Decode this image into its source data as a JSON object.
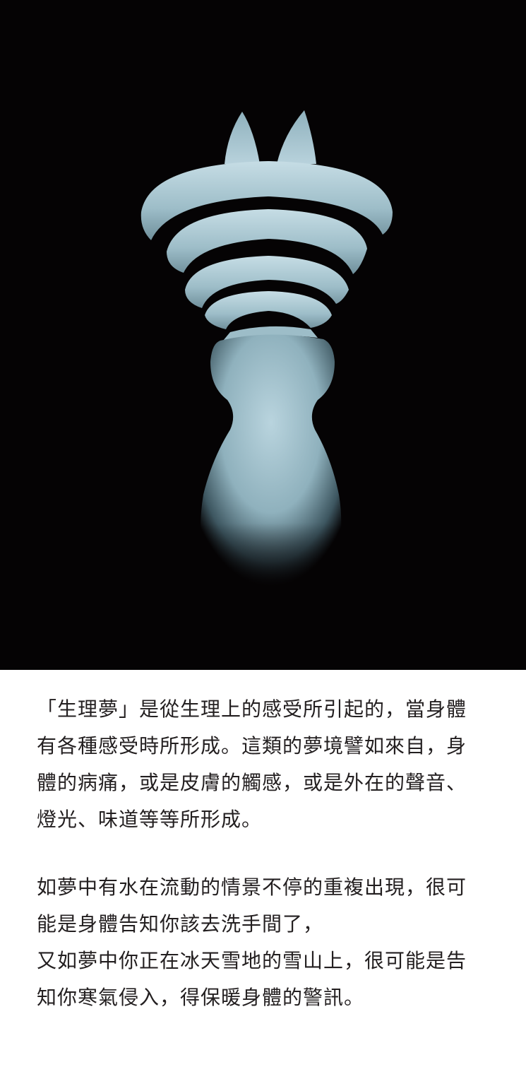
{
  "illustration": {
    "subject": "glowing-chess-piece-figure",
    "background_color": "#050304",
    "figure_color": "#a9cad6"
  },
  "paragraph_1": {
    "lines": [
      "「生理夢」是從生理上的感受所引起的，當身體",
      "有各種感受時所形成。這類的夢境譬如來自，身",
      "體的病痛，或是皮膚的觸感，或是外在的聲音、",
      "燈光、味道等等所形成。"
    ]
  },
  "paragraph_2": {
    "lines": [
      "如夢中有水在流動的情景不停的重複出現，很可",
      "能是身體告知你該去洗手間了，",
      "又如夢中你正在冰天雪地的雪山上，很可能是告",
      "知你寒氣侵入，得保暖身體的警訊。"
    ]
  }
}
